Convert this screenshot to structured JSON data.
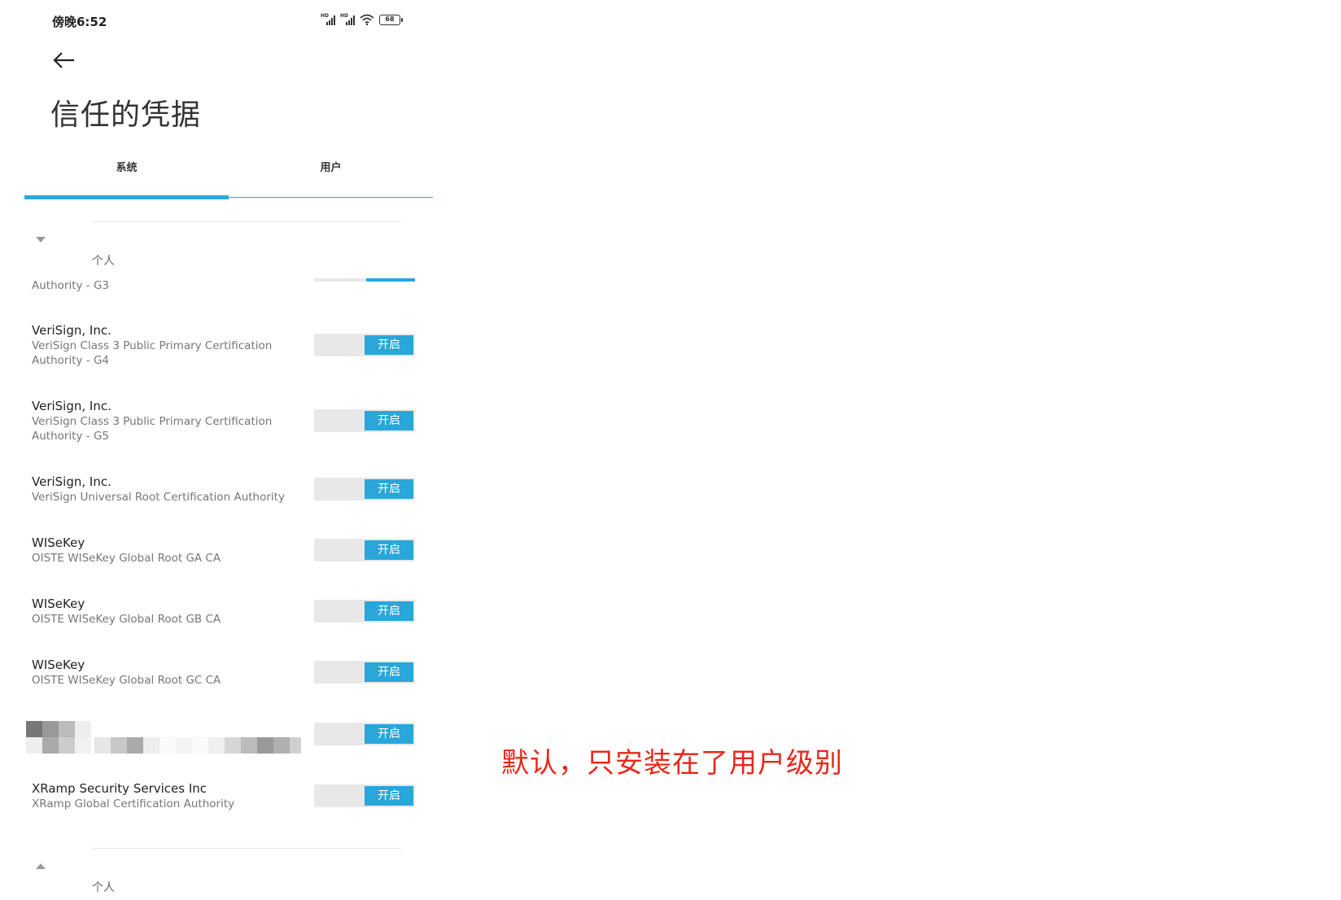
{
  "status_bar": {
    "time": "傍晚6:52",
    "battery": "68",
    "signal_label": "HD"
  },
  "header": {
    "title": "信任的凭据"
  },
  "tabs": [
    {
      "label": "系统"
    },
    {
      "label": "用户"
    }
  ],
  "sections": {
    "top_label": "个人",
    "bottom_label": "个人"
  },
  "partial_row": {
    "cert": "Authority - G3"
  },
  "rows": [
    {
      "org": "VeriSign, Inc.",
      "cert": "VeriSign Class 3 Public Primary Certification Authority - G4",
      "toggle": "开启"
    },
    {
      "org": "VeriSign, Inc.",
      "cert": "VeriSign Class 3 Public Primary Certification Authority - G5",
      "toggle": "开启"
    },
    {
      "org": "VeriSign, Inc.",
      "cert": "VeriSign Universal Root Certification Authority",
      "toggle": "开启"
    },
    {
      "org": "WISeKey",
      "cert": "OISTE WISeKey Global Root GA CA",
      "toggle": "开启"
    },
    {
      "org": "WISeKey",
      "cert": "OISTE WISeKey Global Root GB CA",
      "toggle": "开启"
    },
    {
      "org": "WISeKey",
      "cert": "OISTE WISeKey Global Root GC CA",
      "toggle": "开启"
    },
    {
      "org": "",
      "cert": "",
      "toggle": "开启"
    },
    {
      "org": "XRamp Security Services Inc",
      "cert": "XRamp Global Certification Authority",
      "toggle": "开启"
    }
  ],
  "annotation": {
    "text": "默认，只安装在了用户级别"
  },
  "colors": {
    "accent": "#2ea9de",
    "annotation": "#e8281b"
  }
}
